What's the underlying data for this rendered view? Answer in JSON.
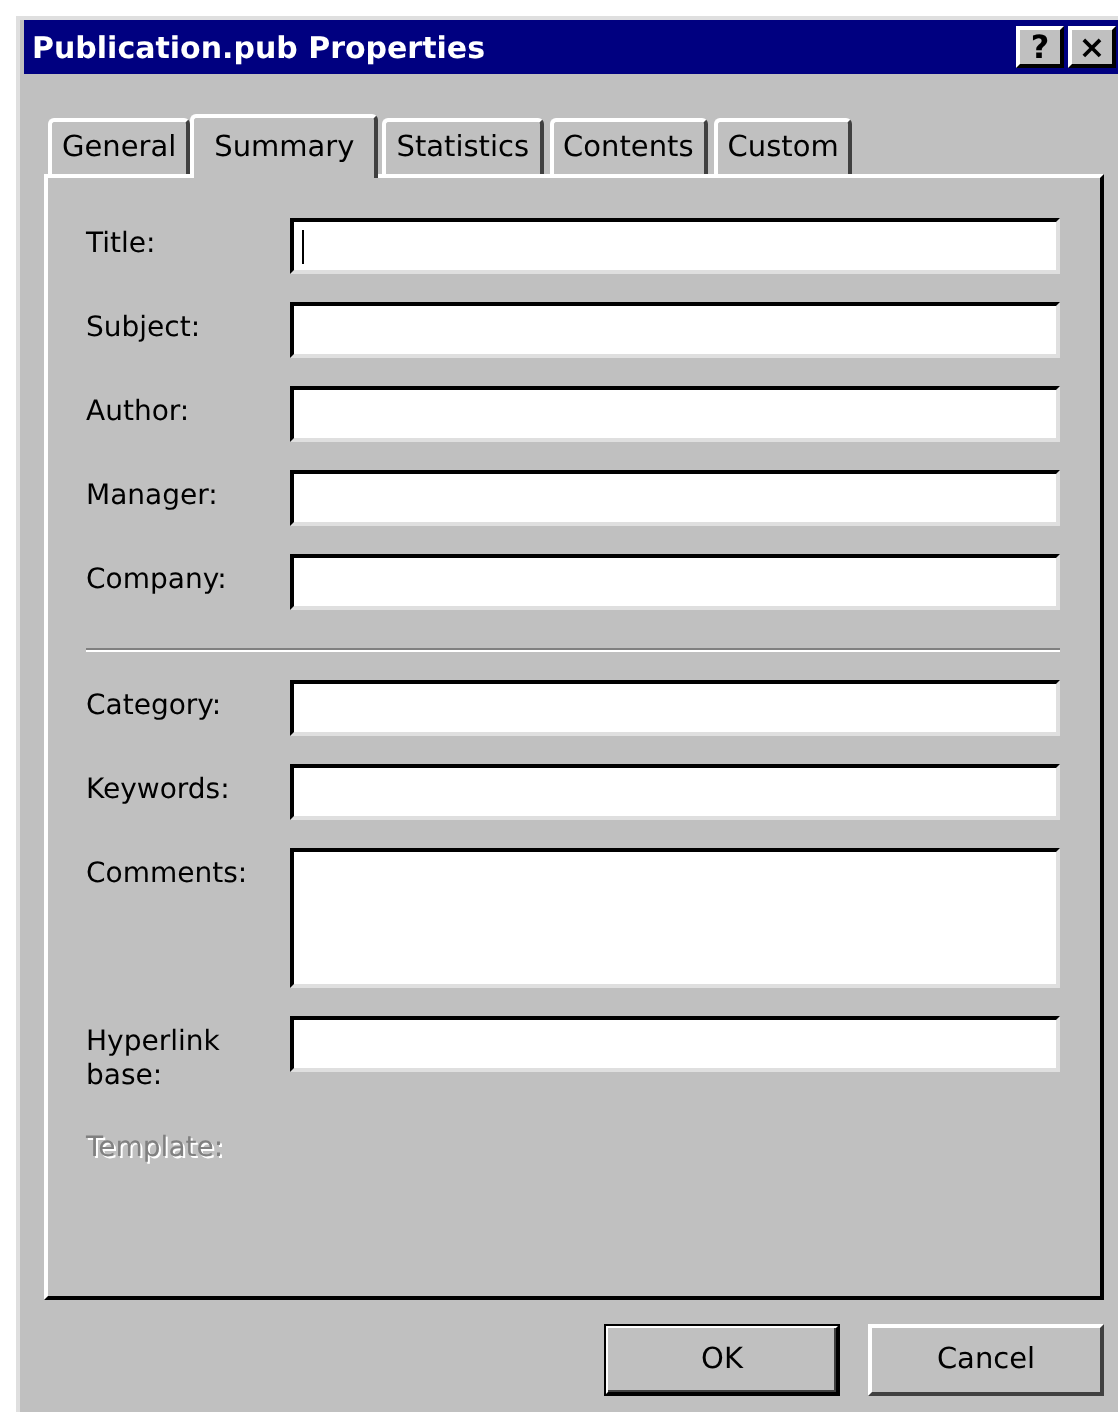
{
  "window": {
    "title": "Publication.pub Properties",
    "help_button": "?",
    "close_button": "×"
  },
  "tabs": [
    {
      "label": "General",
      "selected": false
    },
    {
      "label": "Summary",
      "selected": true
    },
    {
      "label": "Statistics",
      "selected": false
    },
    {
      "label": "Contents",
      "selected": false
    },
    {
      "label": "Custom",
      "selected": false
    }
  ],
  "fields": [
    {
      "label": "Title:",
      "kind": "single",
      "focused": true
    },
    {
      "label": "Subject:",
      "kind": "single",
      "focused": false
    },
    {
      "label": "Author:",
      "kind": "single",
      "focused": false
    },
    {
      "label": "Manager:",
      "kind": "single",
      "focused": false
    },
    {
      "label": "Company:",
      "kind": "single",
      "focused": false
    },
    {
      "kind": "divider"
    },
    {
      "label": "Category:",
      "kind": "single",
      "focused": false
    },
    {
      "label": "Keywords:",
      "kind": "single",
      "focused": false
    },
    {
      "label": "Comments:",
      "kind": "multi",
      "focused": false
    },
    {
      "label": "Hyperlink base:",
      "kind": "single",
      "focused": false
    },
    {
      "label": "Template:",
      "kind": "static",
      "disabled": true
    }
  ],
  "buttons": [
    {
      "label": "OK",
      "default": true
    },
    {
      "label": "Cancel",
      "default": false
    }
  ]
}
